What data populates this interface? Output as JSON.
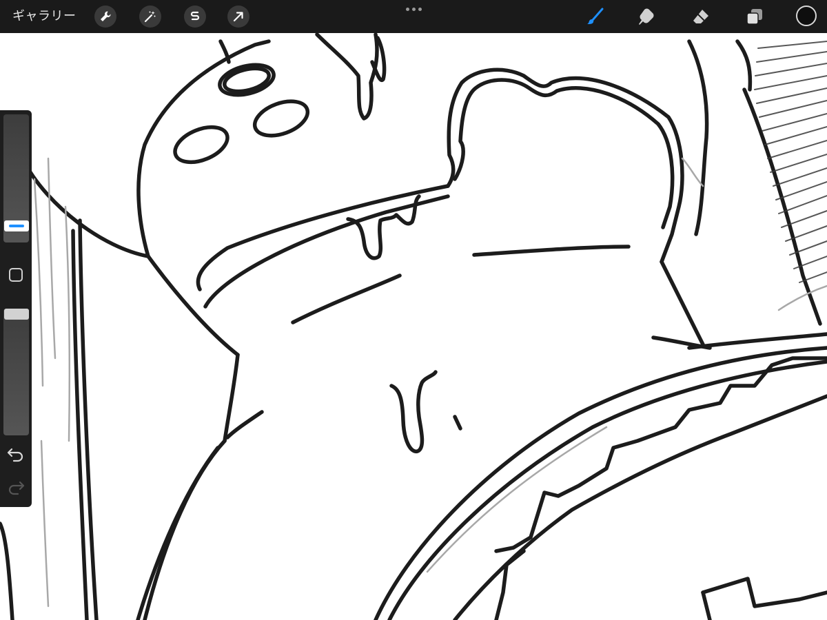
{
  "app": "Procreate",
  "toolbar": {
    "gallery_label": "ギャラリー",
    "left_tools": [
      "wrench-icon",
      "magic-wand-icon",
      "selection-s-icon",
      "transform-arrow-icon"
    ],
    "right_tools": [
      "brush-icon",
      "smudge-icon",
      "eraser-icon",
      "layers-icon"
    ],
    "active_tool": "brush",
    "active_tool_color": "#1e90ff",
    "current_color": "#0e0e0e"
  },
  "sidebar": {
    "brush_size": 0.17,
    "brush_opacity": 1.0,
    "buttons": [
      "undo-icon",
      "redo-icon",
      "modify-button"
    ]
  },
  "colors": {
    "toolbar_bg": "#1a1a1a",
    "sidebar_bg": "#1e1e1e",
    "canvas_bg": "#ffffff",
    "ink": "#1c1c1c",
    "pencil_gray": "#9a9a9a"
  }
}
